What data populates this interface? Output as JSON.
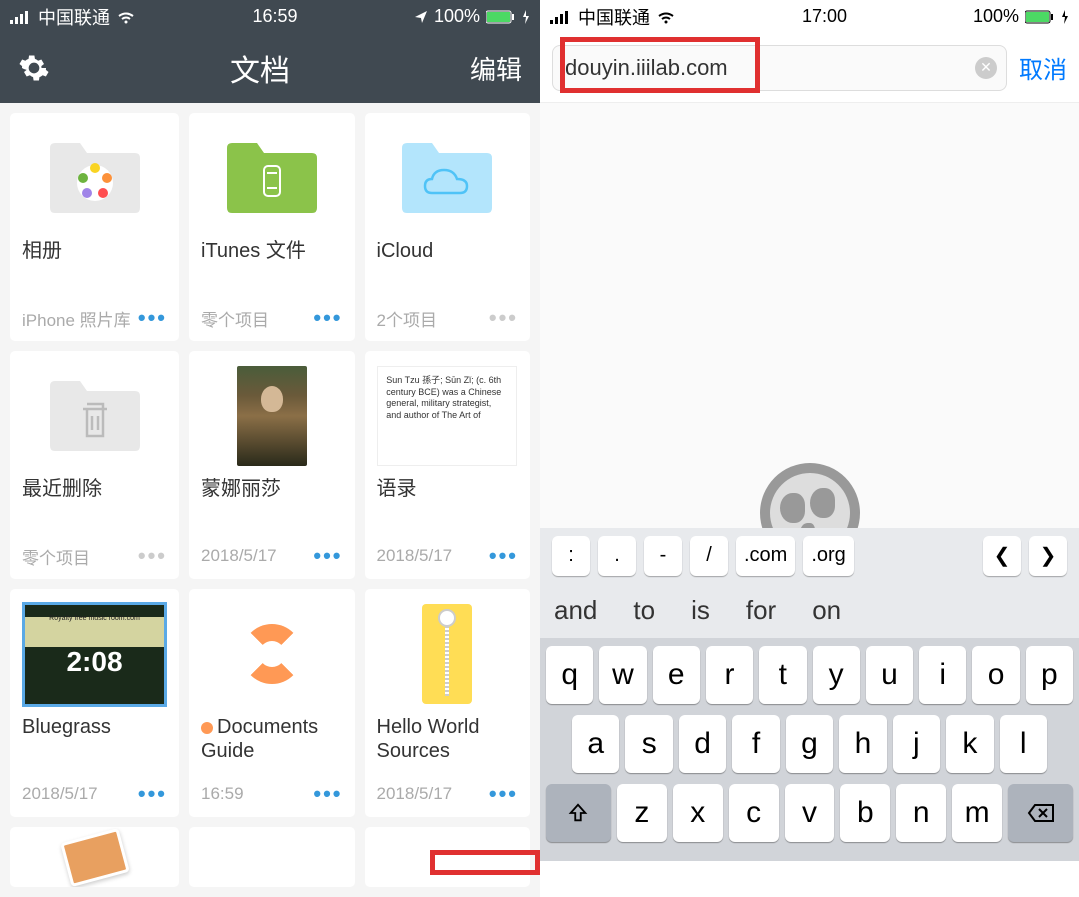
{
  "left": {
    "status": {
      "carrier": "中国联通",
      "time": "16:59",
      "battery": "100%"
    },
    "header": {
      "title": "文档",
      "edit": "编辑"
    },
    "cards": [
      {
        "title": "相册",
        "sub": "iPhone 照片库",
        "dots_gray": false
      },
      {
        "title": "iTunes 文件",
        "sub": "零个项目",
        "dots_gray": false
      },
      {
        "title": "iCloud",
        "sub": "2个项目",
        "dots_gray": true
      },
      {
        "title": "最近删除",
        "sub": "零个项目",
        "dots_gray": true
      },
      {
        "title": "蒙娜丽莎",
        "sub": "2018/5/17",
        "dots_gray": false
      },
      {
        "title": "语录",
        "sub": "2018/5/17",
        "dots_gray": false,
        "doc_text": "Sun Tzu 孫子; Sūn Zǐ; (c. 6th century BCE) was a Chinese general, military strategist, and author of The Art of"
      },
      {
        "title": "Bluegrass",
        "sub": "2018/5/17",
        "dots_gray": false,
        "music_time": "2:08",
        "music_band": "Royalty free music room.com"
      },
      {
        "title": "Documents Guide",
        "sub": "16:59",
        "dots_gray": false,
        "orange": true
      },
      {
        "title": "Hello World Sources",
        "sub": "2018/5/17",
        "dots_gray": false
      }
    ]
  },
  "right": {
    "status": {
      "carrier": "中国联通",
      "time": "17:00",
      "battery": "100%"
    },
    "url": "douyin.iiilab.com",
    "cancel": "取消",
    "shortcuts": [
      ":",
      ".",
      "-",
      "/",
      ".com",
      ".org"
    ],
    "suggestions": [
      "and",
      "to",
      "is",
      "for",
      "on"
    ],
    "row1": [
      "q",
      "w",
      "e",
      "r",
      "t",
      "y",
      "u",
      "i",
      "o",
      "p"
    ],
    "row2": [
      "a",
      "s",
      "d",
      "f",
      "g",
      "h",
      "j",
      "k",
      "l"
    ],
    "row3": [
      "z",
      "x",
      "c",
      "v",
      "b",
      "n",
      "m"
    ]
  }
}
